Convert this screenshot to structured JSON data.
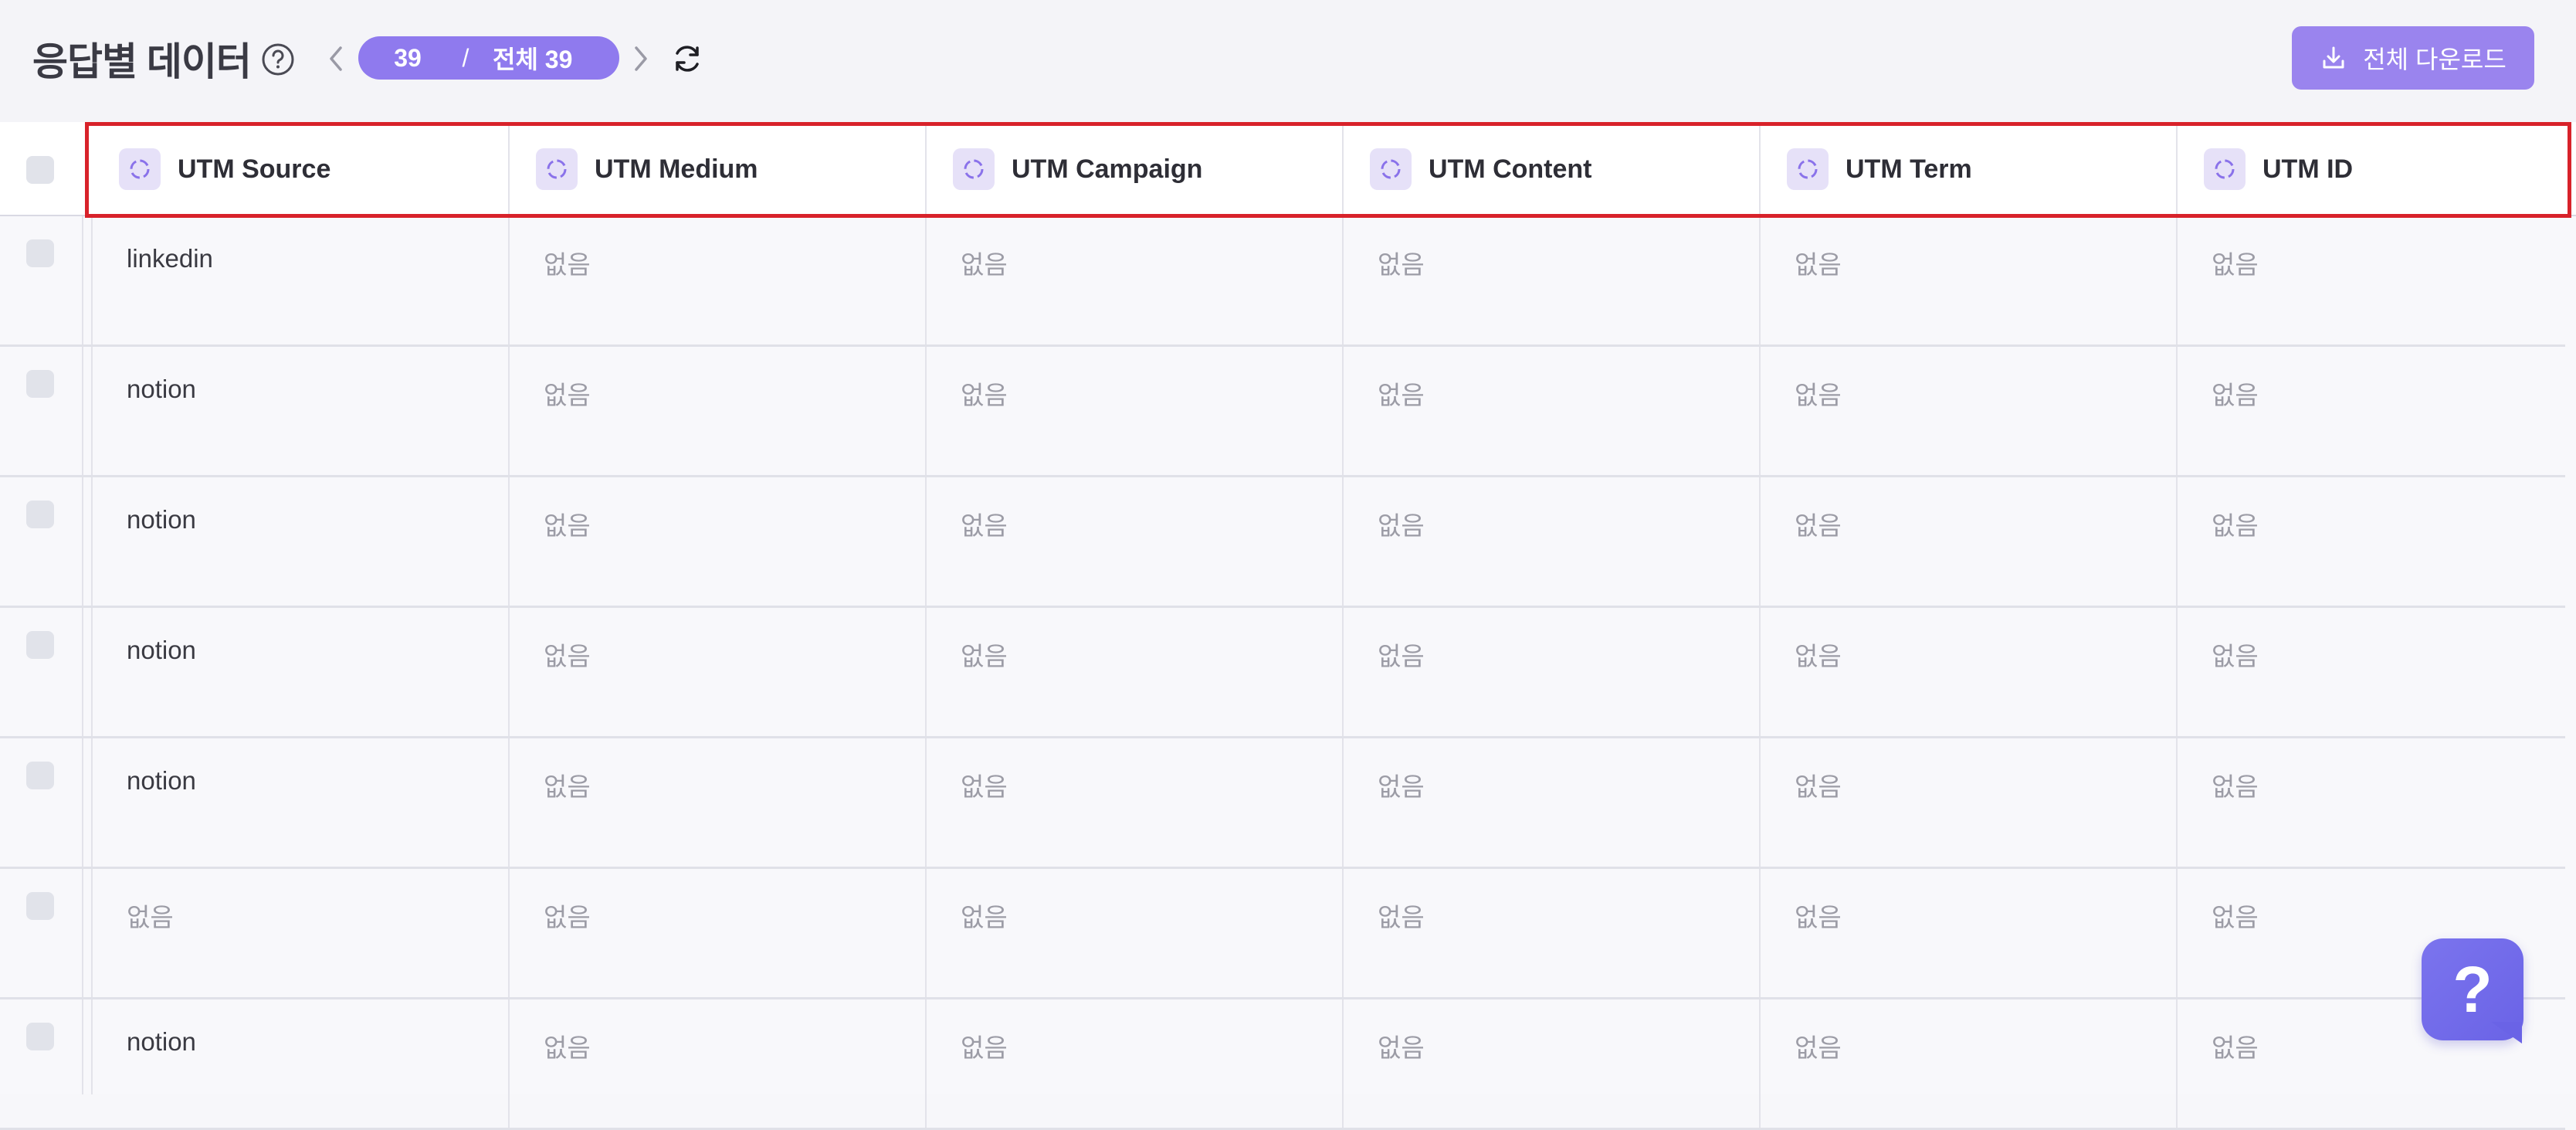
{
  "header": {
    "title": "응답별 데이터",
    "pager": {
      "current": "39",
      "separator": "/",
      "total": "전체 39"
    },
    "download_label": "전체 다운로드"
  },
  "table": {
    "columns": [
      {
        "label": "UTM Source"
      },
      {
        "label": "UTM Medium"
      },
      {
        "label": "UTM Campaign"
      },
      {
        "label": "UTM Content"
      },
      {
        "label": "UTM Term"
      },
      {
        "label": "UTM ID"
      }
    ],
    "rows": [
      [
        "linkedin",
        "없음",
        "없음",
        "없음",
        "없음",
        "없음"
      ],
      [
        "notion",
        "없음",
        "없음",
        "없음",
        "없음",
        "없음"
      ],
      [
        "notion",
        "없음",
        "없음",
        "없음",
        "없음",
        "없음"
      ],
      [
        "notion",
        "없음",
        "없음",
        "없음",
        "없음",
        "없음"
      ],
      [
        "notion",
        "없음",
        "없음",
        "없음",
        "없음",
        "없음"
      ],
      [
        "없음",
        "없음",
        "없음",
        "없음",
        "없음",
        "없음"
      ],
      [
        "notion",
        "없음",
        "없음",
        "없음",
        "없음",
        "없음"
      ]
    ],
    "empty_value": "없음"
  },
  "help_fab": {
    "label": "?"
  },
  "colors": {
    "accent": "#9a84ee",
    "pill": "#8f7aee",
    "highlight": "#d8222a",
    "fab": "#6a63e6"
  },
  "icons": {
    "title_help": "help-circle-icon",
    "prev": "chevron-left-icon",
    "next": "chevron-right-icon",
    "refresh": "refresh-icon",
    "download": "download-icon",
    "column_type": "loading-circle-icon"
  }
}
